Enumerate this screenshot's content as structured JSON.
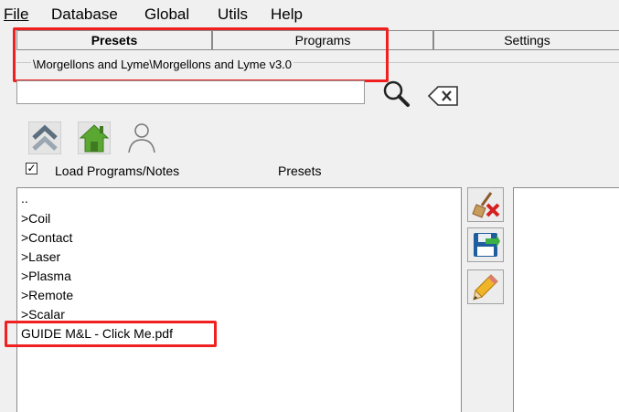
{
  "menu": {
    "file": "File",
    "database": "Database",
    "global": "Global",
    "utils": "Utils",
    "help": "Help"
  },
  "tabs": {
    "presets": "Presets",
    "programs": "Programs",
    "settings": "Settings"
  },
  "path": "\\Morgellons and Lyme\\Morgellons and Lyme v3.0",
  "search": {
    "value": ""
  },
  "load_programs_notes": {
    "label": "Load Programs/Notes",
    "checked": true
  },
  "presets_label": "Presets",
  "list": {
    "items": [
      "..",
      ">Coil",
      ">Contact",
      ">Laser",
      ">Plasma",
      ">Remote",
      ">Scalar",
      "GUIDE M&L - Click Me.pdf"
    ]
  },
  "icons": {
    "search": "magnifier-icon",
    "clear": "backspace-clear-icon",
    "up": "chevron-up-icon",
    "home": "home-icon",
    "users": "users-outline-icon",
    "delete": "broom-delete-icon",
    "save": "save-icon",
    "edit": "pencil-icon"
  },
  "colors": {
    "highlight": "#f02020",
    "home_green": "#5aa832"
  }
}
